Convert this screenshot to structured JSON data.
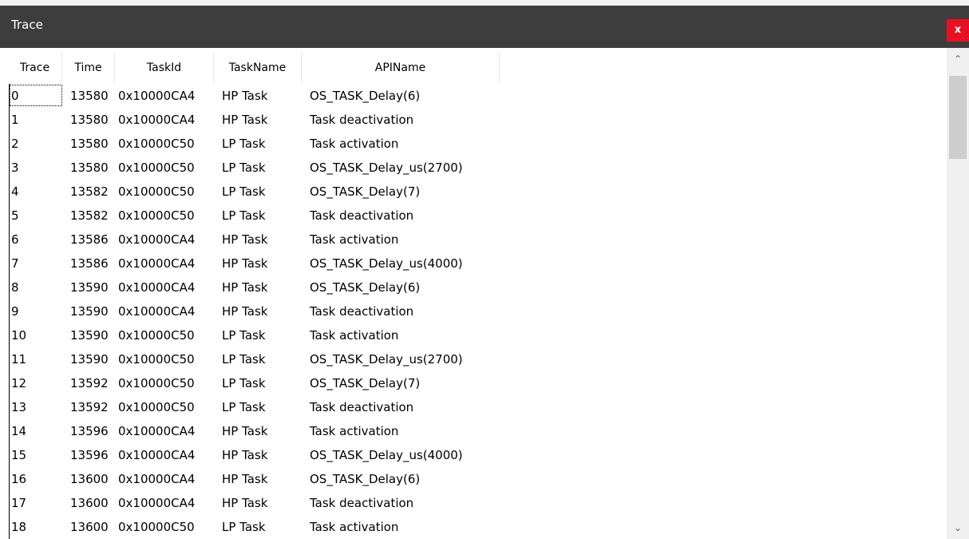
{
  "window": {
    "title": "Trace",
    "close_label": "x"
  },
  "columns": [
    "Trace",
    "Time",
    "TaskId",
    "TaskName",
    "APIName"
  ],
  "rows": [
    {
      "trace": "0",
      "time": "13580",
      "taskid": "0x10000CA4",
      "taskname": "HP Task",
      "api": "OS_TASK_Delay(6)"
    },
    {
      "trace": "1",
      "time": "13580",
      "taskid": "0x10000CA4",
      "taskname": "HP Task",
      "api": "Task deactivation"
    },
    {
      "trace": "2",
      "time": "13580",
      "taskid": "0x10000C50",
      "taskname": "LP Task",
      "api": "Task activation"
    },
    {
      "trace": "3",
      "time": "13580",
      "taskid": "0x10000C50",
      "taskname": "LP Task",
      "api": "OS_TASK_Delay_us(2700)"
    },
    {
      "trace": "4",
      "time": "13582",
      "taskid": "0x10000C50",
      "taskname": "LP Task",
      "api": "OS_TASK_Delay(7)"
    },
    {
      "trace": "5",
      "time": "13582",
      "taskid": "0x10000C50",
      "taskname": "LP Task",
      "api": "Task deactivation"
    },
    {
      "trace": "6",
      "time": "13586",
      "taskid": "0x10000CA4",
      "taskname": "HP Task",
      "api": "Task activation"
    },
    {
      "trace": "7",
      "time": "13586",
      "taskid": "0x10000CA4",
      "taskname": "HP Task",
      "api": "OS_TASK_Delay_us(4000)"
    },
    {
      "trace": "8",
      "time": "13590",
      "taskid": "0x10000CA4",
      "taskname": "HP Task",
      "api": "OS_TASK_Delay(6)"
    },
    {
      "trace": "9",
      "time": "13590",
      "taskid": "0x10000CA4",
      "taskname": "HP Task",
      "api": "Task deactivation"
    },
    {
      "trace": "10",
      "time": "13590",
      "taskid": "0x10000C50",
      "taskname": "LP Task",
      "api": "Task activation"
    },
    {
      "trace": "11",
      "time": "13590",
      "taskid": "0x10000C50",
      "taskname": "LP Task",
      "api": "OS_TASK_Delay_us(2700)"
    },
    {
      "trace": "12",
      "time": "13592",
      "taskid": "0x10000C50",
      "taskname": "LP Task",
      "api": "OS_TASK_Delay(7)"
    },
    {
      "trace": "13",
      "time": "13592",
      "taskid": "0x10000C50",
      "taskname": "LP Task",
      "api": "Task deactivation"
    },
    {
      "trace": "14",
      "time": "13596",
      "taskid": "0x10000CA4",
      "taskname": "HP Task",
      "api": "Task activation"
    },
    {
      "trace": "15",
      "time": "13596",
      "taskid": "0x10000CA4",
      "taskname": "HP Task",
      "api": "OS_TASK_Delay_us(4000)"
    },
    {
      "trace": "16",
      "time": "13600",
      "taskid": "0x10000CA4",
      "taskname": "HP Task",
      "api": "OS_TASK_Delay(6)"
    },
    {
      "trace": "17",
      "time": "13600",
      "taskid": "0x10000CA4",
      "taskname": "HP Task",
      "api": "Task deactivation"
    },
    {
      "trace": "18",
      "time": "13600",
      "taskid": "0x10000C50",
      "taskname": "LP Task",
      "api": "Task activation"
    }
  ],
  "icons": {
    "scroll_up": "chevron-up-icon",
    "scroll_down": "chevron-down-icon"
  },
  "colors": {
    "titlebar": "#3d3d3d",
    "close": "#e81123"
  }
}
